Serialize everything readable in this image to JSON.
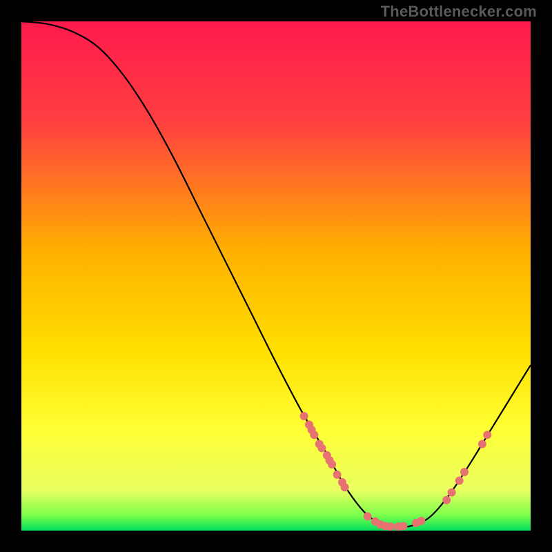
{
  "watermark": "TheBottlenecker.com",
  "chart_data": {
    "type": "line",
    "title": "",
    "xlabel": "",
    "ylabel": "",
    "xlim": [
      0,
      100
    ],
    "ylim": [
      0,
      100
    ],
    "gradient_stops": [
      {
        "offset": 0,
        "color": "#ff1a4d"
      },
      {
        "offset": 20,
        "color": "#ff4040"
      },
      {
        "offset": 45,
        "color": "#ffb000"
      },
      {
        "offset": 65,
        "color": "#ffe000"
      },
      {
        "offset": 80,
        "color": "#ffff33"
      },
      {
        "offset": 92,
        "color": "#eaff60"
      },
      {
        "offset": 97,
        "color": "#7cff4d"
      },
      {
        "offset": 100,
        "color": "#00e05c"
      }
    ],
    "curve": [
      {
        "x": 0.0,
        "y": 100.0
      },
      {
        "x": 5.0,
        "y": 99.5
      },
      {
        "x": 10.0,
        "y": 98.0
      },
      {
        "x": 15.0,
        "y": 95.0
      },
      {
        "x": 20.0,
        "y": 89.5
      },
      {
        "x": 25.0,
        "y": 82.0
      },
      {
        "x": 30.0,
        "y": 73.0
      },
      {
        "x": 35.0,
        "y": 63.0
      },
      {
        "x": 40.0,
        "y": 53.0
      },
      {
        "x": 45.0,
        "y": 43.0
      },
      {
        "x": 50.0,
        "y": 33.0
      },
      {
        "x": 55.0,
        "y": 23.5
      },
      {
        "x": 60.0,
        "y": 15.0
      },
      {
        "x": 64.0,
        "y": 8.0
      },
      {
        "x": 68.0,
        "y": 3.0
      },
      {
        "x": 72.0,
        "y": 0.8
      },
      {
        "x": 76.0,
        "y": 0.8
      },
      {
        "x": 80.0,
        "y": 2.5
      },
      {
        "x": 84.0,
        "y": 7.0
      },
      {
        "x": 88.0,
        "y": 13.0
      },
      {
        "x": 92.0,
        "y": 19.5
      },
      {
        "x": 96.0,
        "y": 26.0
      },
      {
        "x": 100.0,
        "y": 32.5
      }
    ],
    "markers": [
      {
        "x": 55.5,
        "y": 22.5
      },
      {
        "x": 56.5,
        "y": 20.8
      },
      {
        "x": 57.0,
        "y": 19.8
      },
      {
        "x": 57.5,
        "y": 18.8
      },
      {
        "x": 58.5,
        "y": 17.0
      },
      {
        "x": 59.0,
        "y": 16.2
      },
      {
        "x": 60.0,
        "y": 14.8
      },
      {
        "x": 60.5,
        "y": 13.8
      },
      {
        "x": 61.0,
        "y": 13.0
      },
      {
        "x": 62.0,
        "y": 11.0
      },
      {
        "x": 63.0,
        "y": 9.5
      },
      {
        "x": 63.5,
        "y": 8.5
      },
      {
        "x": 68.0,
        "y": 2.8
      },
      {
        "x": 69.5,
        "y": 1.8
      },
      {
        "x": 70.5,
        "y": 1.2
      },
      {
        "x": 71.5,
        "y": 0.9
      },
      {
        "x": 72.5,
        "y": 0.8
      },
      {
        "x": 74.0,
        "y": 0.8
      },
      {
        "x": 75.0,
        "y": 0.9
      },
      {
        "x": 77.5,
        "y": 1.5
      },
      {
        "x": 78.5,
        "y": 1.9
      },
      {
        "x": 83.5,
        "y": 6.0
      },
      {
        "x": 84.5,
        "y": 7.5
      },
      {
        "x": 86.0,
        "y": 9.8
      },
      {
        "x": 87.0,
        "y": 11.5
      },
      {
        "x": 90.5,
        "y": 17.0
      },
      {
        "x": 91.5,
        "y": 18.8
      }
    ],
    "marker_color": "#e77272",
    "curve_color": "#000000"
  }
}
